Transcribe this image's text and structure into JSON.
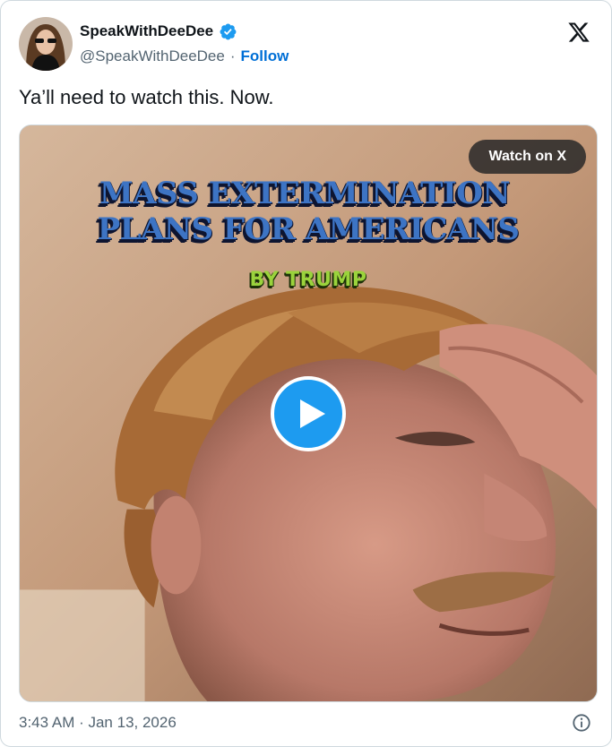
{
  "author": {
    "display_name": "SpeakWithDeeDee",
    "handle": "@SpeakWithDeeDee",
    "separator": "·",
    "follow_label": "Follow",
    "verified_icon": "verified-badge-icon"
  },
  "tweet": {
    "text": "Ya’ll need to watch this. Now."
  },
  "media": {
    "overlay_line1": "MASS EXTERMINATION",
    "overlay_line2": "PLANS FOR AMERICANS",
    "overlay_byline": "BY TRUMP",
    "watch_label": "Watch on X",
    "play_icon": "play-icon"
  },
  "footer": {
    "timestamp": "3:43 AM · Jan 13, 2026",
    "info_icon": "info-icon"
  },
  "colors": {
    "accent": "#1d9bf0",
    "follow": "#006fd6",
    "text_secondary": "#536471",
    "overlay_blue": "#3d74c4",
    "overlay_green": "#9ad33c"
  }
}
